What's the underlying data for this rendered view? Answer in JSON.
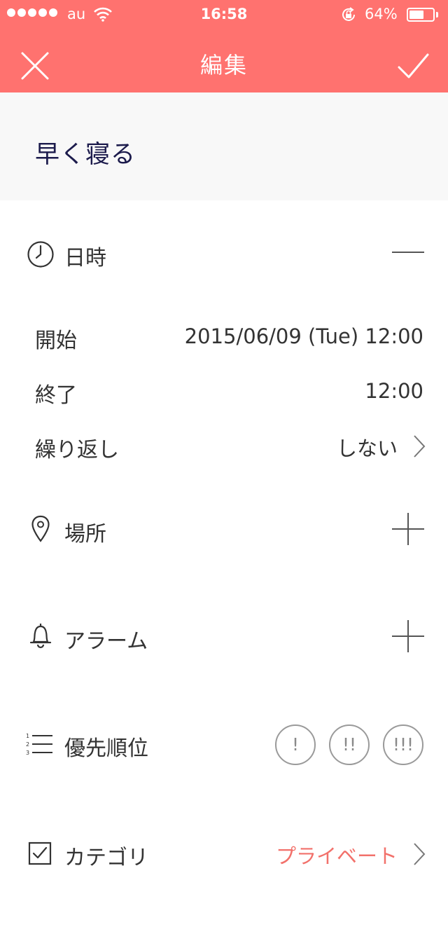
{
  "status_bar": {
    "carrier": "au",
    "time": "16:58",
    "battery": "64%",
    "battery_level": 0.64,
    "signal_icon": "signal-dots-icon",
    "wifi_icon": "wifi-icon",
    "lock_icon": "rotation-lock-icon"
  },
  "nav": {
    "title": "編集",
    "close_icon": "close-icon",
    "done_icon": "checkmark-icon"
  },
  "task": {
    "title": "早く寝る"
  },
  "datetime": {
    "label": "日時",
    "icon": "clock-icon",
    "start_label": "開始",
    "start_value": "2015/06/09 (Tue) 12:00",
    "end_label": "終了",
    "end_value": "12:00",
    "repeat_label": "繰り返し",
    "repeat_value": "しない"
  },
  "location": {
    "label": "場所",
    "icon": "map-pin-icon"
  },
  "alarm": {
    "label": "アラーム",
    "icon": "bell-icon"
  },
  "priority": {
    "label": "優先順位",
    "icon": "numbered-list-icon",
    "options": [
      "!",
      "!!",
      "!!!"
    ]
  },
  "category": {
    "label": "カテゴリ",
    "icon": "checkbox-icon",
    "value": "プライベート"
  },
  "colors": {
    "accent": "#ff726f",
    "category_value": "#f2716b",
    "title_text": "#1c1b4c"
  }
}
